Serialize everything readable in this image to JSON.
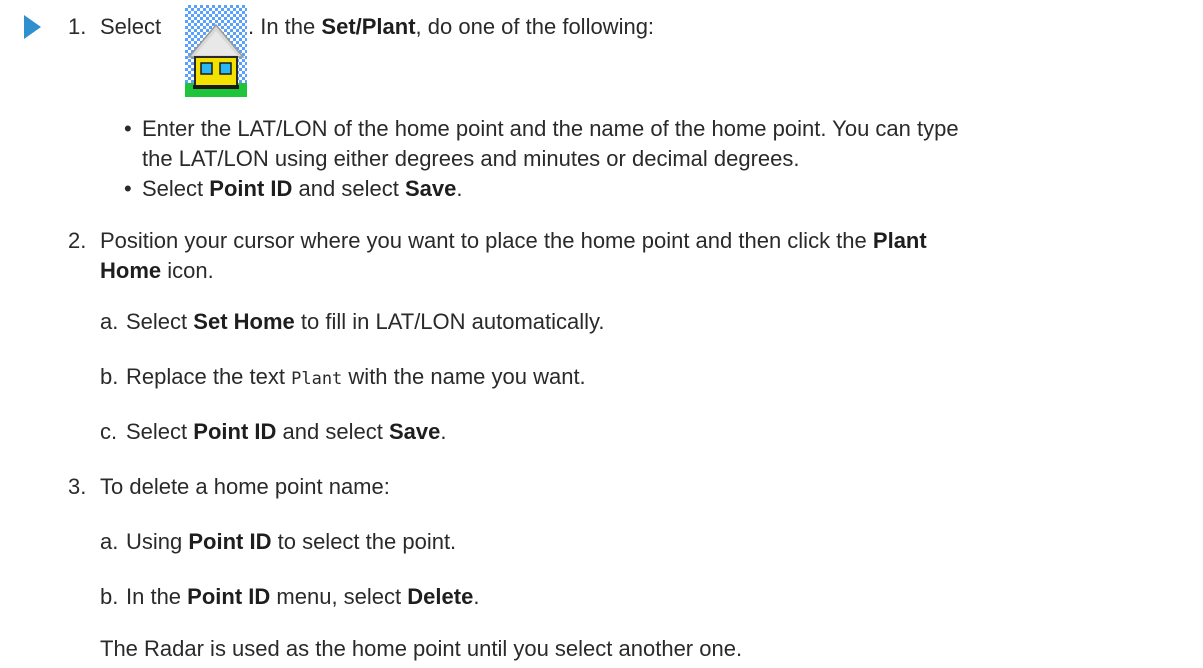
{
  "step1": {
    "number": "1.",
    "lead": "Select",
    "after_icon": ". In the",
    "bold1": "Set/Plant",
    "rest": ", do one of the following:",
    "bullets": [
      {
        "line1": "Enter the LAT/LON of the home point and the name of the home point. You can type",
        "line2": "the LAT/LON using either degrees and minutes or decimal degrees."
      },
      {
        "pre": "Select",
        "b1": "Point ID",
        "mid": "and select",
        "b2": "Save",
        "post": "."
      }
    ]
  },
  "step2": {
    "number": "2.",
    "line1_text": "Position your cursor where you want to place the home point and then click the",
    "line1_bold": "Plant",
    "line2_bold": "Home",
    "line2_text": "icon.",
    "subs": [
      {
        "letter": "a.",
        "pre": "Select",
        "bold": "Set Home",
        "post": "to fill in LAT/LON automatically."
      },
      {
        "letter": "b.",
        "pre": "Replace the text",
        "code": "Plant",
        "post": "with the name you want."
      },
      {
        "letter": "c.",
        "pre": "Select",
        "b1": "Point ID",
        "mid": "and select",
        "b2": "Save",
        "post": "."
      }
    ]
  },
  "step3": {
    "number": "3.",
    "text": "To delete a home point name:",
    "subs": [
      {
        "letter": "a.",
        "pre": "Using",
        "bold": "Point ID",
        "post": "to select the point."
      },
      {
        "letter": "b.",
        "pre": "In the",
        "b1": "Point ID",
        "mid": "menu, select",
        "b2": "Delete",
        "post": "."
      }
    ]
  },
  "note": "The Radar is used as the home point until you select another one.",
  "colors": {
    "marker": "#2f8fcf",
    "text": "#2a2a2a"
  },
  "icons": {
    "step_marker": "triangle-right-icon",
    "plant_home": "plant-home-icon"
  }
}
